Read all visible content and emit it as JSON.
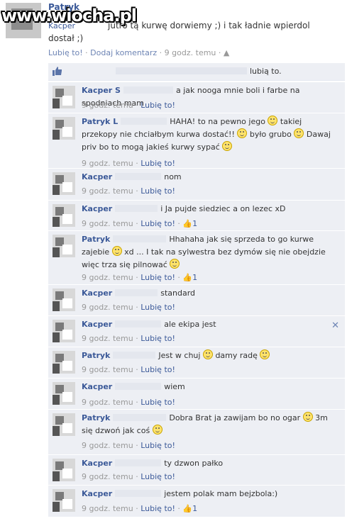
{
  "watermark": "www.wiocha.pl",
  "post": {
    "poster_name": "Patryk",
    "poster_tag": "Kacper",
    "text": "jutro tą kurwę dorwiemy ;) i tak ładnie wpierdol dostał ;)",
    "like_link": "Lubię to!",
    "comment_link": "Dodaj komentarz",
    "time": "9 godz. temu",
    "sep": "·"
  },
  "likes_bar": {
    "text": "lubią to."
  },
  "comments": [
    {
      "name": "Kacper S",
      "text": "a jak nooga mnie boli i farbe na spodniach mam",
      "time": "9 godz. temu",
      "like": "Lubię to!",
      "count": ""
    },
    {
      "name": "Patryk L",
      "text": "HAHA! to na pewno jego  takiej przekopy nie chciałbym kurwa dostać!!  było grubo  Dawaj priv bo to mogą jakieś kurwy sypać ",
      "time": "9 godz. temu",
      "like": "Lubię to!",
      "count": ""
    },
    {
      "name": "Kacper",
      "text": "nom",
      "time": "9 godz. temu",
      "like": "Lubię to!",
      "count": ""
    },
    {
      "name": "Kacper",
      "text": "i Ja pujde siedziec a on lezec xD",
      "time": "9 godz. temu",
      "like": "Lubię to!",
      "count": "1"
    },
    {
      "name": "Patryk",
      "text": "Hhahaha jak się sprzeda to go kurwe zajebie  xd ... I tak na sylwestra bez dymów się nie obejdzie więc trza się pilnować ",
      "time": "9 godz. temu",
      "like": "Lubię to!",
      "count": "1"
    },
    {
      "name": "Kacper",
      "text": "standard",
      "time": "9 godz. temu",
      "like": "Lubię to!",
      "count": ""
    },
    {
      "name": "Kacper",
      "text": "ale ekipa jest",
      "time": "9 godz. temu",
      "like": "Lubię to!",
      "count": ""
    },
    {
      "name": "Patryk",
      "text": "Jest w chuj  damy radę ",
      "time": "9 godz. temu",
      "like": "Lubię to!",
      "count": ""
    },
    {
      "name": "Kacper",
      "text": "wiem",
      "time": "9 godz. temu",
      "like": "Lubię to!",
      "count": ""
    },
    {
      "name": "Patryk",
      "text": "Dobra Brat ja zawijam bo no ogar  3m się dzwoń jak coś ",
      "time": "9 godz. temu",
      "like": "Lubię to!",
      "count": ""
    },
    {
      "name": "Kacper",
      "text": "ty dzwon pałko",
      "time": "9 godz. temu",
      "like": "Lubię to!",
      "count": ""
    },
    {
      "name": "Kacper",
      "text": "jestem polak mam bejzbola:)",
      "time": "9 godz. temu",
      "like": "Lubię to!",
      "count": "1"
    }
  ]
}
